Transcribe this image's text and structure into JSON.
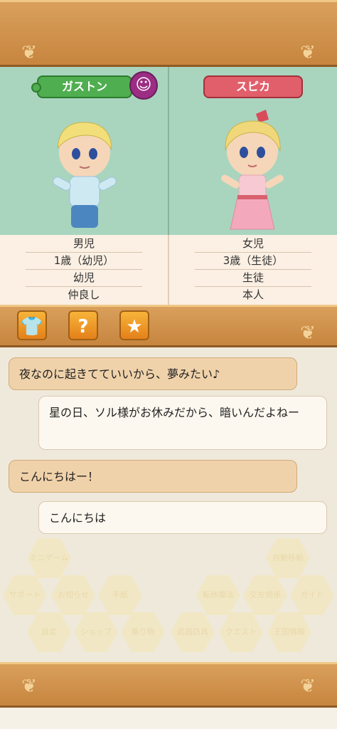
{
  "characters": {
    "left": {
      "name": "ガストン",
      "icon": "smile-icon",
      "info": [
        "男児",
        "1歳（幼児）",
        "幼児",
        "仲良し"
      ]
    },
    "right": {
      "name": "スピカ",
      "info": [
        "女児",
        "3歳（生徒）",
        "生徒",
        "本人"
      ]
    }
  },
  "actions": [
    {
      "icon": "clothing-icon",
      "glyph": "👕"
    },
    {
      "icon": "question-icon",
      "glyph": "?"
    },
    {
      "icon": "star-icon",
      "glyph": "★"
    }
  ],
  "messages": [
    {
      "text": "夜なのに起きてていいから、夢みたい♪",
      "style": "tan"
    },
    {
      "text": "星の日、ソル様がお休みだから、暗いんだよねー",
      "style": "white"
    },
    {
      "text": "こんにちはー！",
      "style": "tan"
    },
    {
      "text": "こんにちは",
      "style": "white"
    }
  ],
  "background_menu": [
    "ミニゲーム",
    "サポート",
    "お知らせ",
    "手紙",
    "自動移動",
    "転移魔法",
    "交友関係",
    "ガイド",
    "設定",
    "ショップ",
    "乗り物",
    "武器防具",
    "クエスト",
    "王国情報"
  ],
  "colors": {
    "frame": "#d9a05c",
    "panel": "#a9d5bf",
    "name_male": "#4fae50",
    "name_female": "#e05f6b",
    "button": "#f39a2a"
  }
}
